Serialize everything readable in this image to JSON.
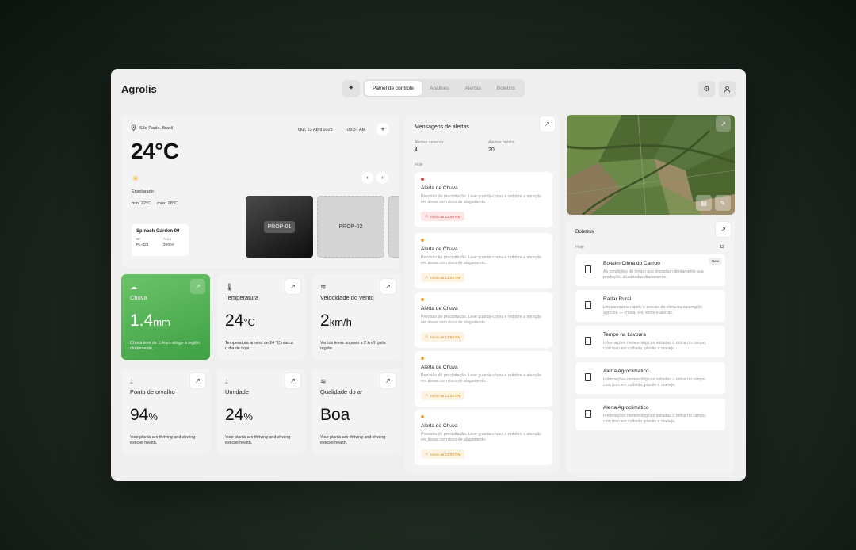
{
  "app": {
    "title": "Agrolis"
  },
  "nav": {
    "tabs": [
      {
        "label": "Painel de controle",
        "active": true
      },
      {
        "label": "Análises"
      },
      {
        "label": "Alertas"
      },
      {
        "label": "Boletins"
      }
    ]
  },
  "weather": {
    "location": "São Paulo, Brasil",
    "date": "Qui, 23 Abril 2025",
    "time": "09:37 AM",
    "temperature": "24°C",
    "condition": "Ensolarado",
    "min": "min: 22°C",
    "max": "máx: 28°C"
  },
  "property": {
    "name": "Spinach Garden 09",
    "id_label": "ID",
    "id_value": "PL-02J",
    "area_label": "Área",
    "area_value": "200m²",
    "tiles": [
      "PROP-01",
      "PROP-02"
    ]
  },
  "metrics": {
    "chuva": {
      "title": "Chuva",
      "value": "1.4",
      "unit": "mm",
      "desc": "Chuva leve de 1.4mm atinge a região diretamente."
    },
    "temperatura": {
      "title": "Temperatura",
      "value": "24",
      "unit": "°C",
      "desc": "Temperatura amena de 24 °C marca o dia de hoje."
    },
    "vento": {
      "title": "Velocidade do vento",
      "value": "2",
      "unit": "km/h",
      "desc": "Ventos leves sopram a 2 km/h pela região."
    },
    "orvalho": {
      "title": "Ponto de orvalho",
      "value": "94",
      "unit": "%",
      "desc": "Your plants are thriving and shwing execlet health."
    },
    "umidade": {
      "title": "Umidade",
      "value": "24",
      "unit": "%",
      "desc": "Your plants are thriving and shwing execlet health."
    },
    "ar": {
      "title": "Qualidade do ar",
      "value": "Boa",
      "unit": "",
      "desc": "Your plants are thriving and shwing execlet health."
    }
  },
  "alerts": {
    "title": "Mensagens de alertas",
    "severe_label": "Alertas severos",
    "severe_count": "4",
    "mid_label": "Alertas médio",
    "mid_count": "20",
    "today_label": "Hoje",
    "items": [
      {
        "title": "Alerta de Chuva",
        "desc": "Previsão de precipitação. Leve guarda-chuva e redobre a atenção em áreas com risco de alagamento.",
        "badge": "Início as 12:00 PM",
        "level": "severe",
        "color": "#d23b3b"
      },
      {
        "title": "Alerta de Chuva",
        "desc": "Previsão de precipitação. Leve guarda-chuva e redobre a atenção em áreas com risco de alagamento.",
        "badge": "Início as 12:00 PM",
        "level": "mid",
        "color": "#e0a43a"
      },
      {
        "title": "Alerta de Chuva",
        "desc": "Previsão de precipitação. Leve guarda-chuva e redobre a atenção em áreas com risco de alagamento.",
        "badge": "Início as 12:00 PM",
        "level": "mid",
        "color": "#e0a43a"
      },
      {
        "title": "Alerta de Chuva",
        "desc": "Previsão de precipitação. Leve guarda-chuva e redobre a atenção em áreas com risco de alagamento.",
        "badge": "Início as 12:00 PM",
        "level": "mid",
        "color": "#e0a43a"
      },
      {
        "title": "Alerta de Chuva",
        "desc": "Previsão de precipitação. Leve guarda-chuva e redobre a atenção em áreas com risco de alagamento.",
        "badge": "Início as 12:00 PM",
        "level": "mid",
        "color": "#e0a43a"
      }
    ]
  },
  "boletins": {
    "title": "Boletins",
    "today_label": "Hoje",
    "count": "12",
    "new_label": "New",
    "items": [
      {
        "title": "Boletim Clima do Campo",
        "desc": "As condições do tempo que impactam diretamente sua produção, atualizadas diariamente."
      },
      {
        "title": "Radar Rural",
        "desc": "Um panorama rápido e preciso do clima na sua região agrícola — chuva, sol, vento e alertas."
      },
      {
        "title": "Tempo na Lavoura",
        "desc": "Informações meteorológicas voltadas à rotina no campo, com foco em colheita, plantio e manejo."
      },
      {
        "title": "Alerta Agroclimático",
        "desc": "Informações meteorológicas voltadas à rotina no campo, com foco em colheita, plantio e manejo."
      },
      {
        "title": "Alerta Agroclimático",
        "desc": "Informações meteorológicas voltadas à rotina no campo, com foco em colheita, plantio e manejo."
      }
    ]
  }
}
